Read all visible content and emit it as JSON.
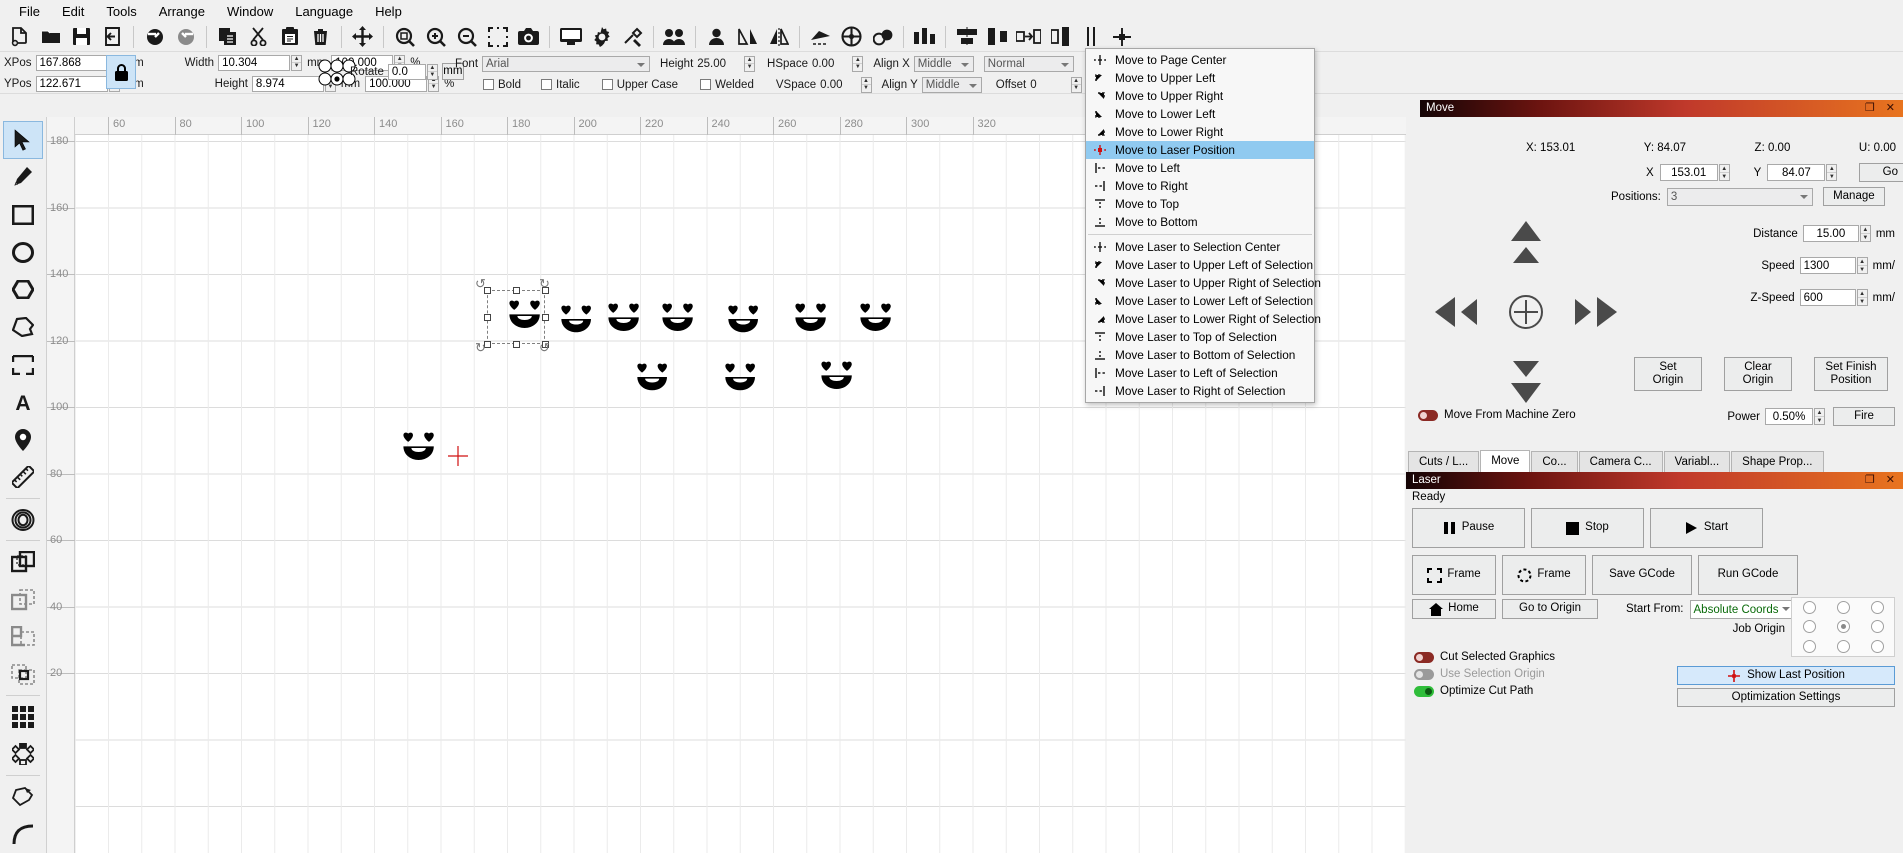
{
  "app": {
    "title": "LightBurn"
  },
  "menubar": {
    "items": [
      "File",
      "Edit",
      "Tools",
      "Arrange",
      "Window",
      "Language",
      "Help"
    ]
  },
  "toolbar": {
    "icons": [
      "new-file-icon",
      "open-folder-icon",
      "save-icon",
      "export-icon",
      "undo-icon",
      "redo-icon",
      "duplicate-icon",
      "cut-icon",
      "paste-icon",
      "delete-icon",
      "move-icon",
      "zoom-fit-icon",
      "zoom-in-icon",
      "zoom-out-icon",
      "marquee-select-icon",
      "camera-icon",
      "monitor-icon",
      "settings-gear-icon",
      "device-settings-icon",
      "group-icon",
      "ungroup-icon",
      "mirror-horizontal-icon",
      "mirror-vertical-icon",
      "rotate-icon",
      "boolean-icon",
      "weld-icon",
      "node-edit-icon",
      "align-left-icon",
      "align-center-icon",
      "align-right-icon",
      "distribute-icon",
      "measure-icon",
      "crosshair-icon"
    ]
  },
  "properties": {
    "xpos_label": "XPos",
    "xpos_value": "167.868",
    "xpos_unit": "mm",
    "ypos_label": "YPos",
    "ypos_value": "122.671",
    "ypos_unit": "mm",
    "lock_icon": "lock-icon",
    "width_label": "Width",
    "width_value": "10.304",
    "width_unit": "mm",
    "width_pct": "100.000",
    "pct_unit": "%",
    "height_label": "Height",
    "height_value": "8.974",
    "height_unit": "mm",
    "height_pct": "100.000",
    "rotate_label": "Rotate",
    "rotate_value": "0.0",
    "rotate_unit": "mm",
    "font_label": "Font",
    "font_value": "Arial",
    "fheight_label": "Height",
    "fheight_value": "25.00",
    "hspace_label": "HSpace",
    "hspace_value": "0.00",
    "vspace_label": "VSpace",
    "vspace_value": "0.00",
    "alignx_label": "Align X",
    "alignx_value": "Middle",
    "aligny_label": "Align Y",
    "aligny_value": "Middle",
    "mode_value": "Normal",
    "offset_label": "Offset",
    "offset_value": "0",
    "bold_label": "Bold",
    "italic_label": "Italic",
    "uppercase_label": "Upper Case",
    "welded_label": "Welded"
  },
  "left_tools": [
    {
      "name": "select-tool",
      "icon": "arrow-cursor-icon",
      "active": true
    },
    {
      "name": "draw-tool",
      "icon": "pencil-icon",
      "active": false
    },
    {
      "name": "rectangle-tool",
      "icon": "rectangle-icon",
      "active": false
    },
    {
      "name": "ellipse-tool",
      "icon": "ellipse-icon",
      "active": false
    },
    {
      "name": "polygon-tool",
      "icon": "hexagon-icon",
      "active": false
    },
    {
      "name": "freehand-tool",
      "icon": "blob-shape-icon",
      "active": false
    },
    {
      "name": "boundary-tool",
      "icon": "bracket-box-icon",
      "active": false
    },
    {
      "name": "text-tool",
      "icon": "letter-a-icon",
      "active": false
    },
    {
      "name": "node-tool",
      "icon": "map-pin-icon",
      "active": false
    },
    {
      "name": "measure-tool",
      "icon": "ruler-icon",
      "active": false
    },
    {
      "name": "offset-tool",
      "icon": "concentric-oval-icon",
      "active": false
    },
    {
      "name": "weld-tool",
      "icon": "union-shapes-icon",
      "active": false
    },
    {
      "name": "subtract-tool",
      "icon": "subtract-shapes-icon",
      "active": false
    },
    {
      "name": "intersect-tool",
      "icon": "intersect-shapes-icon",
      "active": false
    },
    {
      "name": "cutout-tool",
      "icon": "cutout-shapes-icon",
      "active": false
    },
    {
      "name": "grid-array-tool",
      "icon": "grid-array-icon",
      "active": false
    },
    {
      "name": "circular-array-tool",
      "icon": "circular-array-icon",
      "active": false
    },
    {
      "name": "node-edit-tool",
      "icon": "node-edit-shape-icon",
      "active": false
    },
    {
      "name": "curve-tool",
      "icon": "curve-icon",
      "active": false
    }
  ],
  "canvas": {
    "h_ticks": [
      "60",
      "80",
      "100",
      "120",
      "140",
      "160",
      "180",
      "200",
      "220",
      "240",
      "260",
      "280",
      "300",
      "320"
    ],
    "v_ticks": [
      "180",
      "160",
      "140",
      "120",
      "100",
      "80",
      "60",
      "40",
      "20"
    ],
    "selection": {
      "xpos": "167.868",
      "ypos": "122.671"
    }
  },
  "context_menu": {
    "items": [
      {
        "label": "Move to Page Center",
        "icon": "move-center-icon",
        "highlight": false
      },
      {
        "label": "Move to Upper Left",
        "icon": "corner-upper-left-icon",
        "highlight": false
      },
      {
        "label": "Move to Upper Right",
        "icon": "corner-upper-right-icon",
        "highlight": false
      },
      {
        "label": "Move to Lower Left",
        "icon": "corner-lower-left-icon",
        "highlight": false
      },
      {
        "label": "Move to Lower Right",
        "icon": "corner-lower-right-icon",
        "highlight": false
      },
      {
        "label": "Move to Laser Position",
        "icon": "laser-crosshair-icon",
        "highlight": true
      },
      {
        "label": "Move to Left",
        "icon": "edge-left-icon",
        "highlight": false
      },
      {
        "label": "Move to Right",
        "icon": "edge-right-icon",
        "highlight": false
      },
      {
        "label": "Move to Top",
        "icon": "edge-top-icon",
        "highlight": false
      },
      {
        "label": "Move to Bottom",
        "icon": "edge-bottom-icon",
        "highlight": false
      },
      {
        "separator": true
      },
      {
        "label": "Move Laser to Selection Center",
        "icon": "move-center-icon",
        "highlight": false
      },
      {
        "label": "Move Laser to Upper Left of Selection",
        "icon": "corner-upper-left-icon",
        "highlight": false
      },
      {
        "label": "Move Laser to Upper Right of Selection",
        "icon": "corner-upper-right-icon",
        "highlight": false
      },
      {
        "label": "Move Laser to Lower Left of Selection",
        "icon": "corner-lower-left-icon",
        "highlight": false
      },
      {
        "label": "Move Laser to Lower Right of Selection",
        "icon": "corner-lower-right-icon",
        "highlight": false
      },
      {
        "label": "Move Laser to Top of Selection",
        "icon": "edge-top-icon",
        "highlight": false
      },
      {
        "label": "Move Laser to Bottom of Selection",
        "icon": "edge-bottom-icon",
        "highlight": false
      },
      {
        "label": "Move Laser to Left of Selection",
        "icon": "edge-left-icon",
        "highlight": false
      },
      {
        "label": "Move Laser to Right of Selection",
        "icon": "edge-right-icon",
        "highlight": false
      }
    ]
  },
  "move_panel": {
    "title": "Move",
    "readout": {
      "x": "X: 153.01",
      "y": "Y: 84.07",
      "z": "Z: 0.00",
      "u": "U: 0.00"
    },
    "x_label": "X",
    "x_value": "153.01",
    "y_label": "Y",
    "y_value": "84.07",
    "go_label": "Go",
    "positions_label": "Positions:",
    "positions_value": "3",
    "manage_label": "Manage",
    "distance_label": "Distance",
    "distance_value": "15.00",
    "distance_unit": "mm",
    "speed_label": "Speed",
    "speed_value": "1300",
    "speed_unit": "mm/",
    "zspeed_label": "Z-Speed",
    "zspeed_value": "600",
    "zspeed_unit": "mm/",
    "set_origin_label": "Set\nOrigin",
    "clear_origin_label": "Clear\nOrigin",
    "set_finish_label": "Set Finish\nPosition",
    "machine_zero_label": "Move From Machine Zero",
    "power_label": "Power",
    "power_value": "0.50%",
    "fire_label": "Fire"
  },
  "tabs": [
    {
      "label": "Cuts / L...",
      "active": false
    },
    {
      "label": "Move",
      "active": true
    },
    {
      "label": "Co...",
      "active": false
    },
    {
      "label": "Camera C...",
      "active": false
    },
    {
      "label": "Variabl...",
      "active": false
    },
    {
      "label": "Shape Prop...",
      "active": false
    }
  ],
  "laser_panel": {
    "title": "Laser",
    "status": "Ready",
    "pause_label": "Pause",
    "stop_label": "Stop",
    "start_label": "Start",
    "frame_square_label": "Frame",
    "frame_circle_label": "Frame",
    "save_gcode_label": "Save GCode",
    "run_gcode_label": "Run GCode",
    "home_label": "Home",
    "go_to_origin_label": "Go to Origin",
    "start_from_label": "Start From:",
    "start_from_value": "Absolute Coords",
    "job_origin_label": "Job Origin",
    "cut_selected_label": "Cut Selected Graphics",
    "use_selection_origin_label": "Use Selection Origin",
    "optimize_cut_label": "Optimize Cut Path",
    "show_last_position_label": "Show Last Position",
    "optimization_settings_label": "Optimization Settings"
  },
  "colors": {
    "highlight": "#90caf0",
    "panel_bar_start": "#140405",
    "panel_bar_end": "#e8741f",
    "accent_blue": "#5b9bd5",
    "laser_red": "#d01010"
  }
}
